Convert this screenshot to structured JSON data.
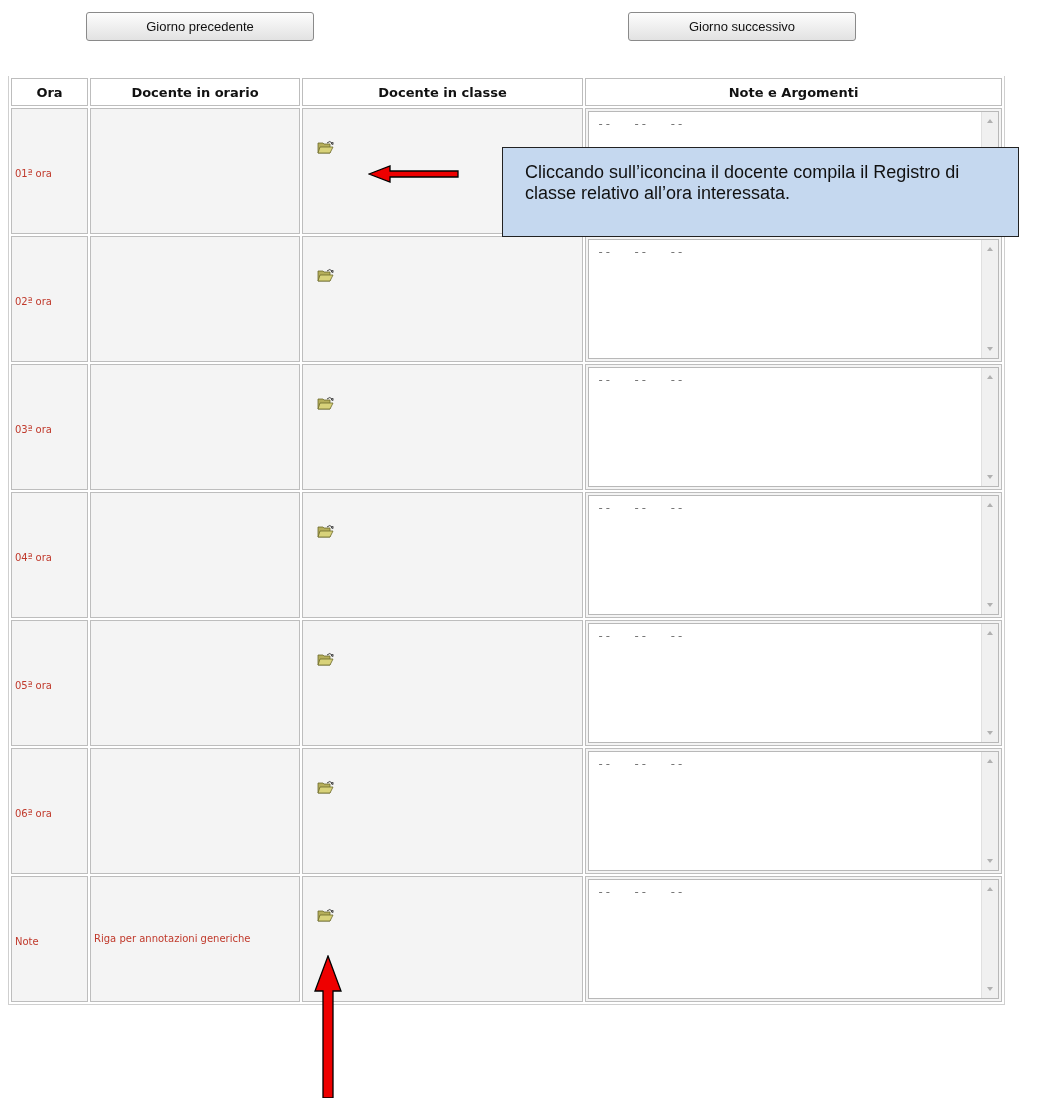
{
  "buttons": [
    {
      "label": "Giorno precedente"
    },
    {
      "label": "Giorno successivo"
    }
  ],
  "table": {
    "columns": [
      "Ora",
      "Docente in orario",
      "Docente in classe",
      "Note e Argomenti"
    ],
    "rows": [
      {
        "ora": "01ª ora",
        "notes": "--   --   --"
      },
      {
        "ora": "02ª ora",
        "notes": "--   --   --"
      },
      {
        "ora": "03ª ora",
        "notes": "--   --   --"
      },
      {
        "ora": "04ª ora",
        "notes": "--   --   --"
      },
      {
        "ora": "05ª ora",
        "notes": "--   --   --"
      },
      {
        "ora": "06ª ora",
        "notes": "--   --   --"
      },
      {
        "ora": "Note",
        "docente_in_orario": "Riga per annotazioni generiche",
        "notes": "--   --   --"
      }
    ]
  },
  "callout": {
    "text": "Cliccando sull’iconcina il docente compila il Registro di classe relativo all’ora interessata."
  }
}
